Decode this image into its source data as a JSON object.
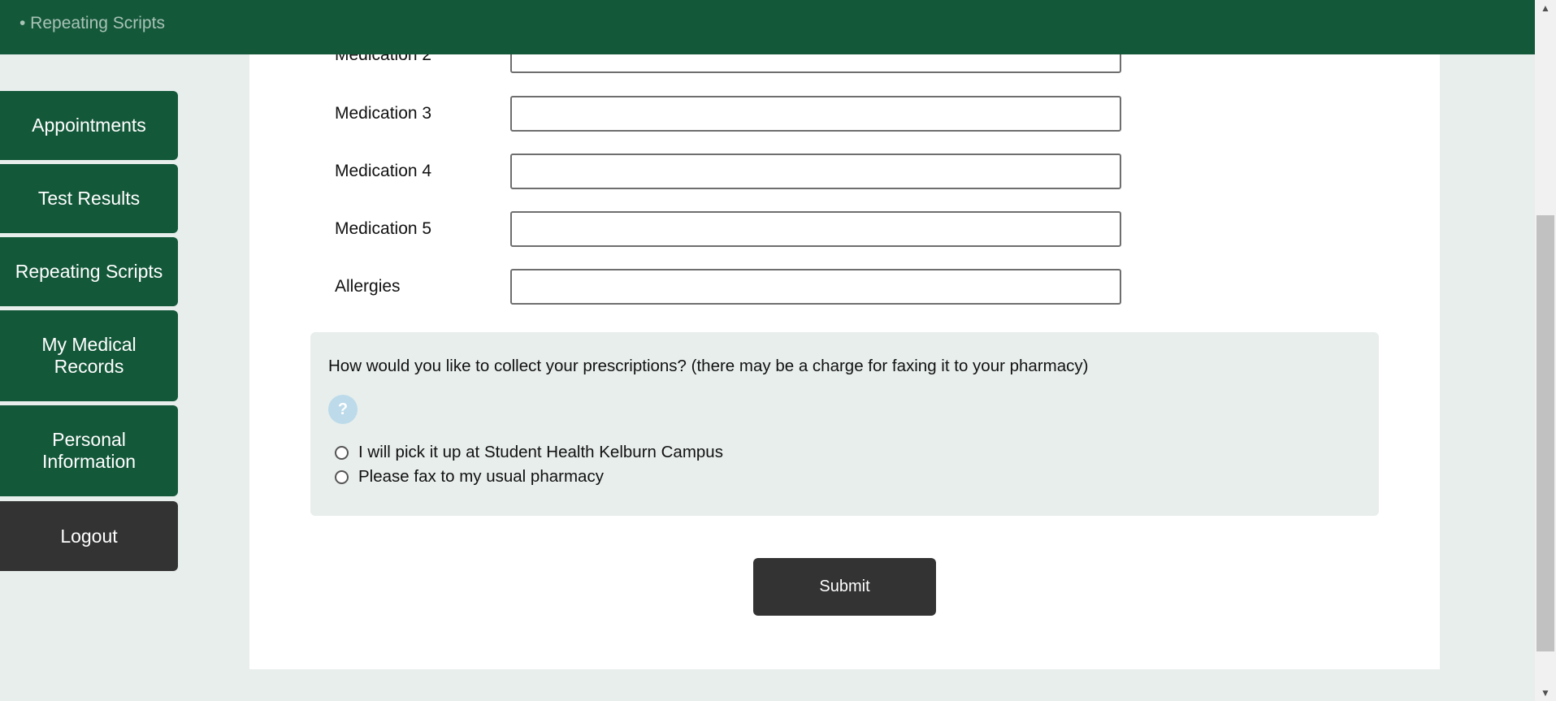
{
  "header": {
    "breadcrumb": "• Repeating Scripts"
  },
  "sidebar": {
    "items": [
      {
        "label": "Appointments"
      },
      {
        "label": "Test Results"
      },
      {
        "label": "Repeating Scripts"
      },
      {
        "label": "My Medical Records"
      },
      {
        "label": "Personal Information"
      },
      {
        "label": "Logout"
      }
    ]
  },
  "form": {
    "fields": [
      {
        "label": "Medication 2",
        "value": ""
      },
      {
        "label": "Medication 3",
        "value": ""
      },
      {
        "label": "Medication 4",
        "value": ""
      },
      {
        "label": "Medication 5",
        "value": ""
      },
      {
        "label": "Allergies",
        "value": ""
      }
    ],
    "collection": {
      "question": "How would you like to collect your prescriptions? (there may be a charge for faxing it to your pharmacy)",
      "help_icon": "question-mark-icon",
      "help_symbol": "?",
      "options": [
        {
          "label": "I will pick it up at Student Health Kelburn Campus",
          "selected": false
        },
        {
          "label": "Please fax to my usual pharmacy",
          "selected": false
        }
      ]
    },
    "submit_label": "Submit"
  },
  "colors": {
    "brand_green": "#14583a",
    "dark_button": "#333333",
    "page_background": "#e7eeec",
    "help_icon": "#bcdaea"
  }
}
